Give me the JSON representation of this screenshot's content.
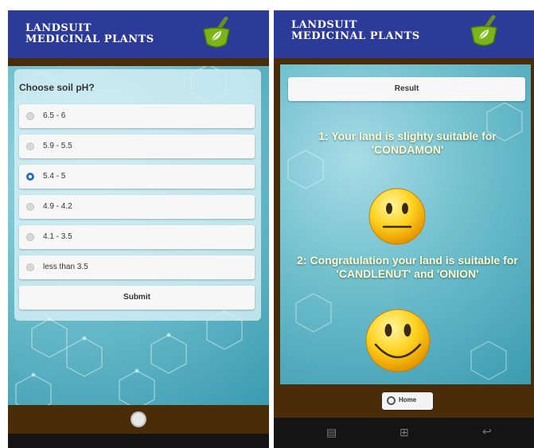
{
  "app": {
    "title": "LANDSUIT\nMEDICINAL PLANTS"
  },
  "quiz": {
    "question": "Choose soil pH?",
    "options": [
      "6.5 - 6",
      "5.9 - 5.5",
      "5.4 - 5",
      "4.9 - 4.2",
      "4.1 - 3.5",
      "less than 3.5"
    ],
    "selected_option": "5.4 - 5",
    "submit_label": "Submit"
  },
  "result": {
    "heading": "Result",
    "message_1": "1: Your land is slighty suitable for 'CONDAMON'",
    "message_2": "2: Congratulation your land is suitable for 'CANDLENUT' and 'ONION'",
    "emoji_1": "neutral-face",
    "emoji_2": "smiling-face",
    "home_label": "Home"
  },
  "colors": {
    "header": "#2c3b98",
    "brown_bar": "#4a2c08",
    "teal_background": "#5db3c4",
    "selected_radio": "#2a6fb6",
    "result_text": "#ffffcc"
  },
  "icons": [
    "mortar-pestle-leaf-icon",
    "home-icon",
    "recent-apps-icon",
    "qr-scan-icon",
    "back-icon"
  ]
}
